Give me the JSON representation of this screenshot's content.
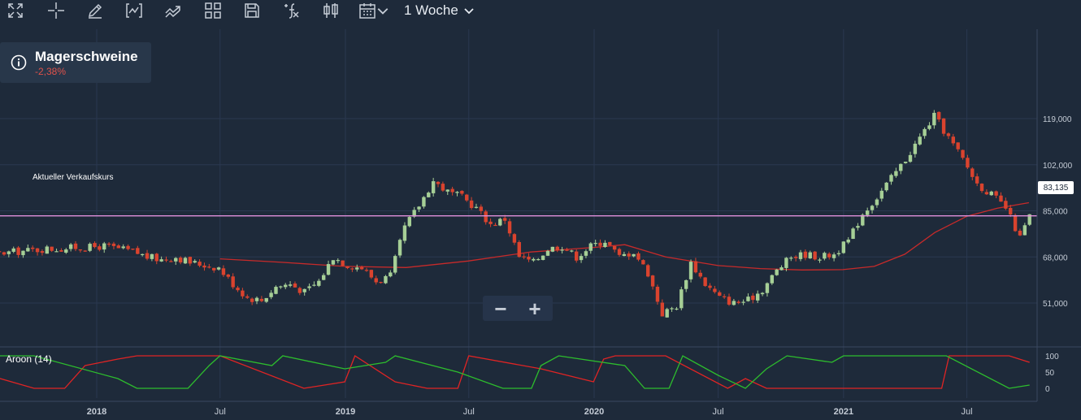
{
  "toolbar": {
    "icons": [
      "fullscreen-icon",
      "crosshair-icon",
      "pencil-icon",
      "chart-type-icon",
      "trend-icon",
      "layout-grid-icon",
      "save-icon",
      "formula-icon",
      "candlestick-icon",
      "calendar-icon"
    ],
    "period_label": "1 Woche"
  },
  "info": {
    "name": "Magerschweine",
    "change": "-2,38%"
  },
  "price_line": {
    "label": "Aktueller Verkaufskurs",
    "value": "83,135"
  },
  "zoom": {
    "minus": "−",
    "plus": "+"
  },
  "indicator": {
    "label": "Aroon (14)"
  },
  "colors": {
    "background": "#1e2a3a",
    "up": "#a6cf96",
    "down": "#d9432e",
    "ma": "#c72a2a",
    "price_line": "#e08fdb",
    "aroon_up": "#2dbd2d",
    "aroon_down": "#e02424"
  },
  "chart_data": {
    "type": "candlestick",
    "y_ticks": [
      "119,000",
      "102,000",
      "85,000",
      "68,000",
      "51,000"
    ],
    "y_tick_values": [
      119,
      102,
      85,
      68,
      51
    ],
    "x_ticks": [
      "2018",
      "Jul",
      "2019",
      "Jul",
      "2020",
      "Jul",
      "2021",
      "Jul"
    ],
    "x_tick_dates": [
      "2018-01-01",
      "2018-07-01",
      "2019-01-01",
      "2019-07-01",
      "2020-01-01",
      "2020-07-01",
      "2021-01-01",
      "2021-07-01"
    ],
    "current_price": 83.135,
    "series": [
      {
        "name": "Magerschweine",
        "type": "candlestick",
        "points": [
          [
            "2017-05-05",
            65.5
          ],
          [
            "2017-05-26",
            66.5
          ],
          [
            "2017-06-16",
            67.5
          ],
          [
            "2017-07-07",
            68
          ],
          [
            "2017-07-28",
            69
          ],
          [
            "2017-08-18",
            69.5
          ],
          [
            "2017-09-08",
            70
          ],
          [
            "2017-09-29",
            70.5
          ],
          [
            "2017-10-20",
            71
          ],
          [
            "2017-11-10",
            71
          ],
          [
            "2017-12-01",
            71.5
          ],
          [
            "2017-12-22",
            71.5
          ],
          [
            "2018-01-12",
            72
          ],
          [
            "2018-02-02",
            71
          ],
          [
            "2018-02-23",
            70
          ],
          [
            "2018-03-16",
            68
          ],
          [
            "2018-04-06",
            67
          ],
          [
            "2018-04-27",
            68
          ],
          [
            "2018-05-18",
            66
          ],
          [
            "2018-06-08",
            65
          ],
          [
            "2018-06-29",
            64
          ],
          [
            "2018-07-20",
            58
          ],
          [
            "2018-08-10",
            53
          ],
          [
            "2018-08-31",
            52
          ],
          [
            "2018-09-21",
            57
          ],
          [
            "2018-10-12",
            58
          ],
          [
            "2018-11-02",
            55
          ],
          [
            "2018-11-23",
            59
          ],
          [
            "2018-12-14",
            68
          ],
          [
            "2019-01-04",
            65
          ],
          [
            "2019-01-25",
            64
          ],
          [
            "2019-02-15",
            59
          ],
          [
            "2019-03-08",
            61
          ],
          [
            "2019-03-29",
            79
          ],
          [
            "2019-04-19",
            87
          ],
          [
            "2019-05-10",
            96
          ],
          [
            "2019-05-31",
            92
          ],
          [
            "2019-06-21",
            90
          ],
          [
            "2019-07-12",
            86
          ],
          [
            "2019-08-02",
            80
          ],
          [
            "2019-08-23",
            82
          ],
          [
            "2019-09-13",
            68
          ],
          [
            "2019-10-04",
            66
          ],
          [
            "2019-10-25",
            71
          ],
          [
            "2019-11-15",
            72
          ],
          [
            "2019-12-06",
            68
          ],
          [
            "2019-12-27",
            72
          ],
          [
            "2020-01-17",
            74
          ],
          [
            "2020-02-07",
            68
          ],
          [
            "2020-02-28",
            70
          ],
          [
            "2020-03-20",
            62
          ],
          [
            "2020-04-10",
            47
          ],
          [
            "2020-05-01",
            50
          ],
          [
            "2020-05-22",
            66
          ],
          [
            "2020-06-12",
            58
          ],
          [
            "2020-07-03",
            53
          ],
          [
            "2020-07-24",
            51
          ],
          [
            "2020-08-14",
            52
          ],
          [
            "2020-09-04",
            56
          ],
          [
            "2020-09-25",
            63
          ],
          [
            "2020-10-16",
            68
          ],
          [
            "2020-11-06",
            69
          ],
          [
            "2020-11-27",
            68
          ],
          [
            "2020-12-18",
            69
          ],
          [
            "2021-01-08",
            74
          ],
          [
            "2021-01-29",
            84
          ],
          [
            "2021-02-19",
            90
          ],
          [
            "2021-03-12",
            97
          ],
          [
            "2021-04-02",
            104
          ],
          [
            "2021-04-23",
            112
          ],
          [
            "2021-05-14",
            120
          ],
          [
            "2021-06-04",
            112
          ],
          [
            "2021-06-25",
            104
          ],
          [
            "2021-07-16",
            95
          ],
          [
            "2021-08-06",
            91
          ],
          [
            "2021-08-27",
            86
          ],
          [
            "2021-09-17",
            75
          ],
          [
            "2021-10-01",
            83.1
          ]
        ]
      },
      {
        "name": "MA",
        "type": "line",
        "points": [
          [
            "2018-07-01",
            67.3
          ],
          [
            "2018-09-30",
            66
          ],
          [
            "2018-12-31",
            64.5
          ],
          [
            "2019-03-31",
            64.1
          ],
          [
            "2019-06-30",
            66.5
          ],
          [
            "2019-09-30",
            69.8
          ],
          [
            "2019-12-31",
            71.5
          ],
          [
            "2020-02-15",
            72.5
          ],
          [
            "2020-04-15",
            68
          ],
          [
            "2020-07-01",
            64.8
          ],
          [
            "2020-09-01",
            63.7
          ],
          [
            "2020-11-01",
            63.2
          ],
          [
            "2020-12-31",
            63.3
          ],
          [
            "2021-02-15",
            64.5
          ],
          [
            "2021-04-01",
            69
          ],
          [
            "2021-05-15",
            77
          ],
          [
            "2021-07-01",
            83
          ],
          [
            "2021-08-15",
            86
          ],
          [
            "2021-09-30",
            88
          ]
        ]
      }
    ],
    "aroon": {
      "ticks": [
        "100",
        "50",
        "0"
      ],
      "up": [
        [
          "2017-05-05",
          100
        ],
        [
          "2017-06-01",
          80
        ],
        [
          "2017-07-01",
          100
        ],
        [
          "2017-10-01",
          100
        ],
        [
          "2018-02-01",
          30
        ],
        [
          "2018-03-01",
          0
        ],
        [
          "2018-05-15",
          0
        ],
        [
          "2018-06-15",
          70
        ],
        [
          "2018-07-01",
          100
        ],
        [
          "2018-09-15",
          70
        ],
        [
          "2018-10-01",
          100
        ],
        [
          "2018-12-31",
          60
        ],
        [
          "2019-03-01",
          80
        ],
        [
          "2019-03-15",
          100
        ],
        [
          "2019-06-15",
          50
        ],
        [
          "2019-08-20",
          0
        ],
        [
          "2019-10-01",
          0
        ],
        [
          "2019-10-15",
          70
        ],
        [
          "2019-11-10",
          100
        ],
        [
          "2020-02-15",
          70
        ],
        [
          "2020-03-15",
          0
        ],
        [
          "2020-04-20",
          0
        ],
        [
          "2020-05-10",
          100
        ],
        [
          "2020-07-01",
          40
        ],
        [
          "2020-08-10",
          0
        ],
        [
          "2020-09-10",
          60
        ],
        [
          "2020-10-10",
          100
        ],
        [
          "2020-12-15",
          80
        ],
        [
          "2021-01-01",
          100
        ],
        [
          "2021-06-01",
          100
        ],
        [
          "2021-09-01",
          0
        ],
        [
          "2021-10-01",
          10
        ]
      ],
      "down": [
        [
          "2017-05-05",
          90
        ],
        [
          "2017-10-01",
          0
        ],
        [
          "2017-11-15",
          0
        ],
        [
          "2017-12-15",
          70
        ],
        [
          "2018-02-01",
          90
        ],
        [
          "2018-03-01",
          100
        ],
        [
          "2018-07-01",
          100
        ],
        [
          "2018-11-01",
          0
        ],
        [
          "2018-12-31",
          20
        ],
        [
          "2019-01-15",
          100
        ],
        [
          "2019-03-15",
          20
        ],
        [
          "2019-05-01",
          0
        ],
        [
          "2019-06-15",
          0
        ],
        [
          "2019-07-01",
          100
        ],
        [
          "2019-10-15",
          60
        ],
        [
          "2019-12-31",
          20
        ],
        [
          "2020-01-15",
          90
        ],
        [
          "2020-02-01",
          100
        ],
        [
          "2020-04-15",
          100
        ],
        [
          "2020-07-15",
          0
        ],
        [
          "2020-08-10",
          30
        ],
        [
          "2020-09-10",
          0
        ],
        [
          "2021-05-25",
          0
        ],
        [
          "2021-06-05",
          100
        ],
        [
          "2021-09-01",
          100
        ],
        [
          "2021-10-01",
          80
        ]
      ]
    }
  }
}
